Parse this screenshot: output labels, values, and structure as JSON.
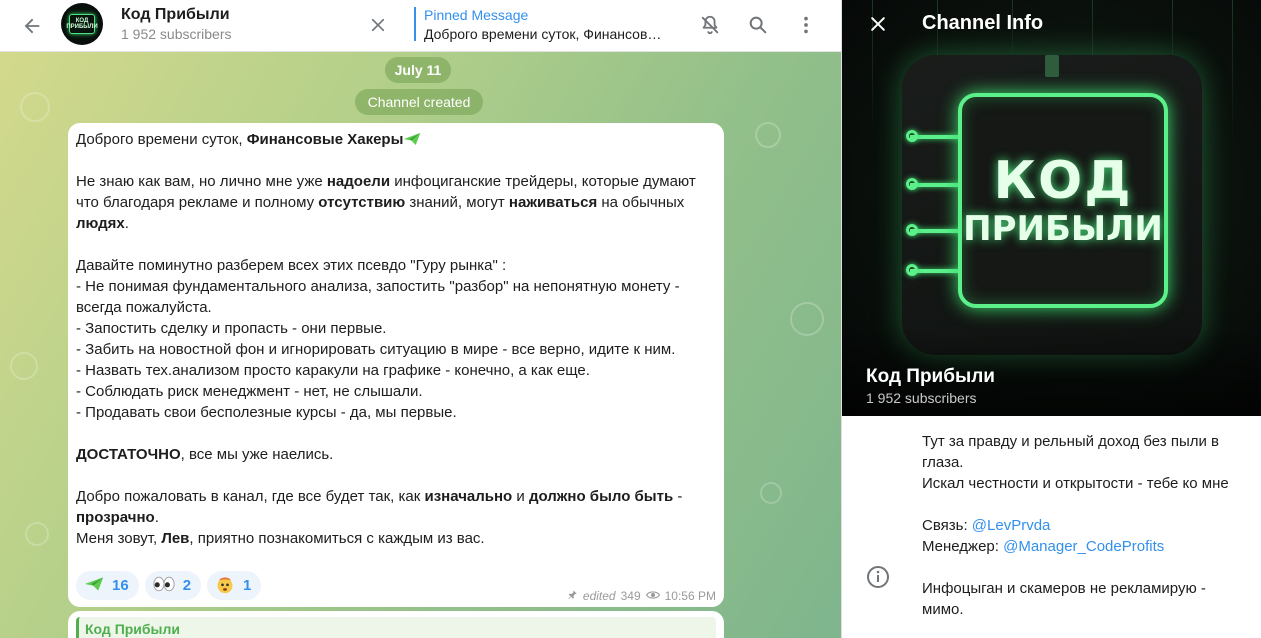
{
  "header": {
    "title": "Код Прибыли",
    "subscribers": "1 952 subscribers",
    "avatar_text_line1": "КОД",
    "avatar_text_line2": "ПРИБЫЛИ",
    "pinned_title": "Pinned Message",
    "pinned_text": "Доброго времени суток, Финансов…"
  },
  "chat": {
    "date_pill": "July 11",
    "service_message": "Channel created",
    "message": {
      "p1_a": "Доброго времени суток, ",
      "p1_b": "Финансовые Хакеры",
      "p2_a": "Не знаю как вам, но лично мне уже ",
      "p2_b": "надоели",
      "p2_c": " инфоциганские трейдеры, которые думают что благодаря рекламе и полному ",
      "p2_d": "отсутствию",
      "p2_e": " знаний, могут ",
      "p2_f": "наживаться",
      "p2_g": " на обычных ",
      "p2_h": "людях",
      "p2_i": ".",
      "p3": "Давайте поминутно разберем всех этих псевдо \"Гуру рынка\" :\n- Не понимая фундаментального анализа, запостить \"разбор\" на непонятную монету - всегда пожалуйста.\n- Запостить сделку и пропасть - они первые.\n- Забить на новостной фон и игнорировать ситуацию в мире - все верно, идите к ним.\n- Назвать тех.анализом просто каракули на графике - конечно, а как еще.\n- Соблюдать риск менеджмент - нет, не слышали.\n- Продавать свои бесполезные курсы - да, мы первые.",
      "p4_a": "ДОСТАТОЧНО",
      "p4_b": ", все мы уже наелись.",
      "p5_a": "Добро пожаловать в канал, где все будет так, как ",
      "p5_b": "изначально",
      "p5_c": " и ",
      "p5_d": "должно было быть",
      "p5_e": " - ",
      "p5_f": "прозрачно",
      "p5_g": ".",
      "p6_a": "Меня зовут, ",
      "p6_b": "Лев",
      "p6_c": ", приятно познакомиться с каждым из вас."
    },
    "reactions": [
      {
        "icon": "paper-plane",
        "count": "16"
      },
      {
        "icon": "eyes",
        "count": "2"
      },
      {
        "icon": "exploding-head",
        "count": "1"
      }
    ],
    "meta": {
      "edited": "edited",
      "views": "349",
      "time": "10:56 PM"
    },
    "next_message_author": "Код Прибыли"
  },
  "info": {
    "panel_title": "Channel Info",
    "channel_name": "Код Прибыли",
    "subscribers": "1 952 subscribers",
    "cover_line1": "КОД",
    "cover_line2": "ПРИБЫЛИ",
    "about_1": "Тут за правду и рельный доход без пыли в глаза.\nИскал честности и открытости - тебе ко мне\n\nСвязь: ",
    "about_link1": "@LevPrvda",
    "about_2": "\nМенеджер: ",
    "about_link2": "@Manager_CodeProfits",
    "about_3": "\n\nИнфоцыган и скамеров не рекламирую - мимо."
  },
  "colors": {
    "accent": "#3390ec",
    "neon_green": "#5cf08a",
    "reaction_bg": "#eef4fb"
  }
}
